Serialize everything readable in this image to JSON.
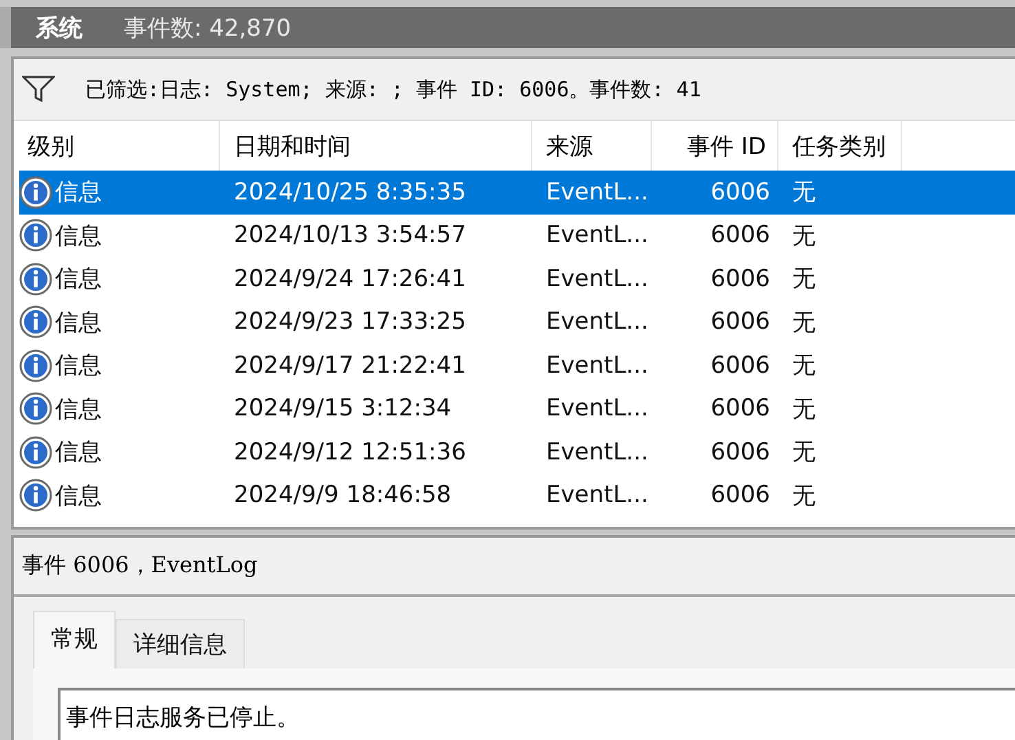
{
  "header": {
    "title": "系统",
    "event_count": "事件数: 42,870"
  },
  "filter": {
    "text": "已筛选:日志: System; 来源: ; 事件 ID: 6006。事件数: 41"
  },
  "table": {
    "columns": [
      "级别",
      "日期和时间",
      "来源",
      "事件 ID",
      "任务类别"
    ],
    "rows": [
      {
        "level": "信息",
        "datetime": "2024/10/25 8:35:35",
        "source": "EventL...",
        "event_id": "6006",
        "task": "无",
        "selected": true
      },
      {
        "level": "信息",
        "datetime": "2024/10/13 3:54:57",
        "source": "EventL...",
        "event_id": "6006",
        "task": "无",
        "selected": false
      },
      {
        "level": "信息",
        "datetime": "2024/9/24 17:26:41",
        "source": "EventL...",
        "event_id": "6006",
        "task": "无",
        "selected": false
      },
      {
        "level": "信息",
        "datetime": "2024/9/23 17:33:25",
        "source": "EventL...",
        "event_id": "6006",
        "task": "无",
        "selected": false
      },
      {
        "level": "信息",
        "datetime": "2024/9/17 21:22:41",
        "source": "EventL...",
        "event_id": "6006",
        "task": "无",
        "selected": false
      },
      {
        "level": "信息",
        "datetime": "2024/9/15 3:12:34",
        "source": "EventL...",
        "event_id": "6006",
        "task": "无",
        "selected": false
      },
      {
        "level": "信息",
        "datetime": "2024/9/12 12:51:36",
        "source": "EventL...",
        "event_id": "6006",
        "task": "无",
        "selected": false
      },
      {
        "level": "信息",
        "datetime": "2024/9/9 18:46:58",
        "source": "EventL...",
        "event_id": "6006",
        "task": "无",
        "selected": false
      }
    ]
  },
  "detail": {
    "title": "事件 6006，EventLog",
    "tabs": [
      {
        "label": "常规",
        "selected": true
      },
      {
        "label": "详细信息",
        "selected": false
      }
    ],
    "message": "事件日志服务已停止。"
  }
}
